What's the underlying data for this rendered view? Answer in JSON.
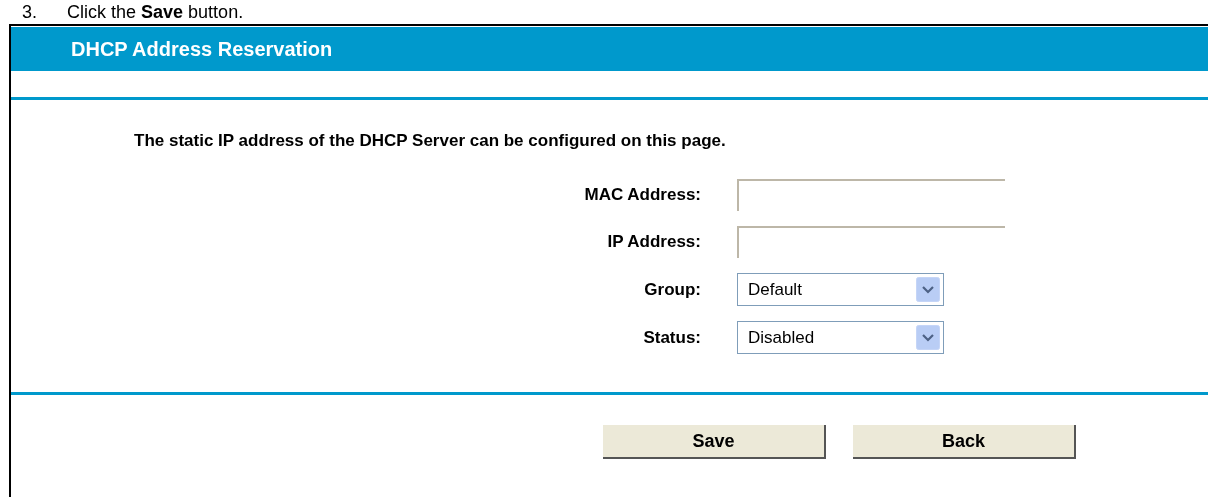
{
  "instruction": {
    "number": "3.",
    "text": "Click the **Save** button."
  },
  "panel": {
    "title": "DHCP Address Reservation",
    "description": "The static IP address of the DHCP Server can be configured on this page.",
    "fields": [
      {
        "kind": "text",
        "label": "MAC Address:"
      },
      {
        "kind": "text",
        "label": "IP Address:"
      },
      {
        "kind": "select",
        "label": "Group:",
        "value": "Default"
      },
      {
        "kind": "select",
        "label": "Status:",
        "value": "Disabled"
      }
    ],
    "buttons": [
      "Save",
      "Back"
    ]
  }
}
